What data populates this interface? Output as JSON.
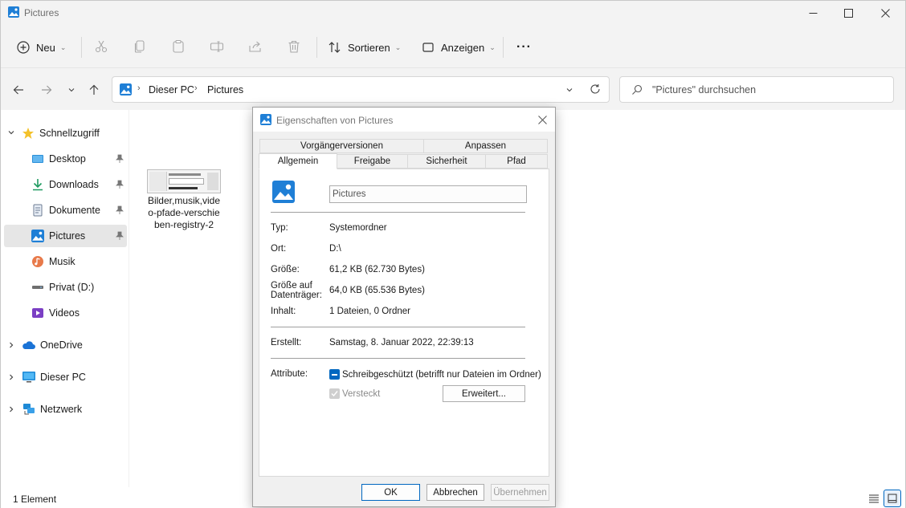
{
  "window": {
    "title": "Pictures"
  },
  "toolbar": {
    "new_label": "Neu",
    "sort_label": "Sortieren",
    "view_label": "Anzeigen",
    "more_label": "···"
  },
  "address": {
    "crumbs": [
      "Dieser PC",
      "Pictures"
    ],
    "search_placeholder": "\"Pictures\" durchsuchen"
  },
  "sidebar": {
    "quick_access": "Schnellzugriff",
    "items": [
      {
        "label": "Desktop",
        "icon": "desktop-icon",
        "pinned": true
      },
      {
        "label": "Downloads",
        "icon": "download-icon",
        "pinned": true
      },
      {
        "label": "Dokumente",
        "icon": "document-icon",
        "pinned": true
      },
      {
        "label": "Pictures",
        "icon": "pictures-icon",
        "pinned": true,
        "selected": true
      },
      {
        "label": "Musik",
        "icon": "music-icon"
      },
      {
        "label": "Privat (D:)",
        "icon": "drive-icon"
      },
      {
        "label": "Videos",
        "icon": "video-icon"
      }
    ],
    "onedrive": "OneDrive",
    "this_pc": "Dieser PC",
    "network": "Netzwerk"
  },
  "content": {
    "files": [
      {
        "name": "Bilder,musik,video-pfade-verschieben-registry-2"
      }
    ]
  },
  "statusbar": {
    "count": "1 Element"
  },
  "dialog": {
    "title": "Eigenschaften von Pictures",
    "tabs_row1": [
      "Vorgängerversionen",
      "Anpassen"
    ],
    "tabs_row2": [
      "Allgemein",
      "Freigabe",
      "Sicherheit",
      "Pfad"
    ],
    "active_tab": "Allgemein",
    "name": "Pictures",
    "props": {
      "type_label": "Typ:",
      "type_value": "Systemordner",
      "location_label": "Ort:",
      "location_value": "D:\\",
      "size_label": "Größe:",
      "size_value": "61,2 KB (62.730 Bytes)",
      "disk_label_1": "Größe auf",
      "disk_label_2": "Datenträger:",
      "disk_value": "64,0 KB (65.536 Bytes)",
      "contents_label": "Inhalt:",
      "contents_value": "1 Dateien, 0 Ordner",
      "created_label": "Erstellt:",
      "created_value": "Samstag, 8. Januar 2022, 22:39:13",
      "attributes_label": "Attribute:",
      "readonly_label": "Schreibgeschützt (betrifft nur Dateien im Ordner)",
      "hidden_label": "Versteckt",
      "advanced_label": "Erweitert..."
    },
    "buttons": {
      "ok": "OK",
      "cancel": "Abbrechen",
      "apply": "Übernehmen"
    }
  },
  "colors": {
    "accent": "#0067c0",
    "selection": "#e6e6e6",
    "chrome": "#f3f3f3"
  }
}
